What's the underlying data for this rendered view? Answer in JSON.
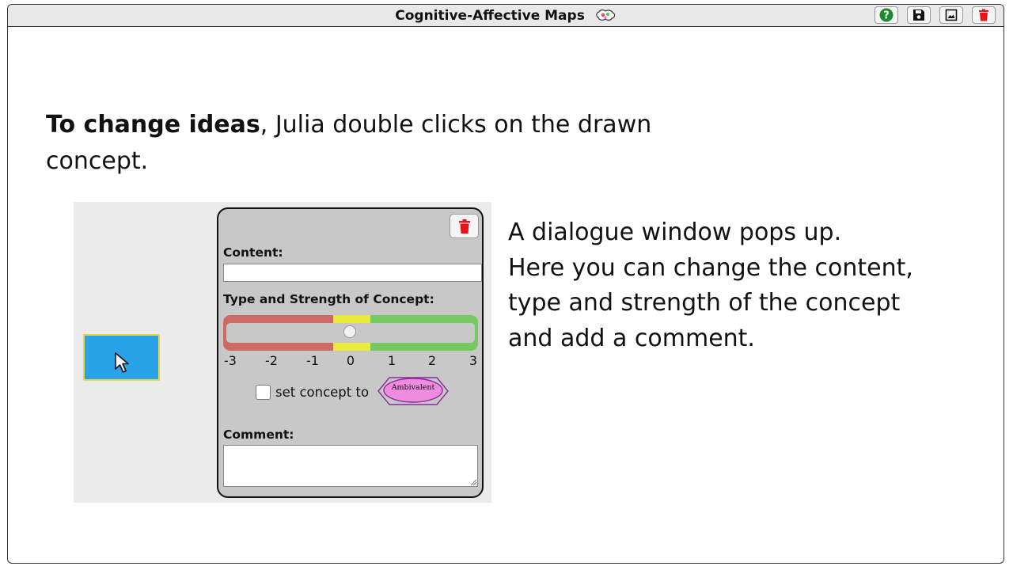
{
  "window": {
    "title": "Cognitive-Affective Maps",
    "buttons": [
      {
        "name": "help",
        "icon": "help-icon"
      },
      {
        "name": "save",
        "icon": "save-icon"
      },
      {
        "name": "image",
        "icon": "image-icon"
      },
      {
        "name": "delete",
        "icon": "trash-icon"
      }
    ]
  },
  "intro": {
    "bold": "To change ideas",
    "rest": ", Julia double clicks on the drawn",
    "line2": "concept."
  },
  "dialog": {
    "content_label": "Content:",
    "content_value": "",
    "type_label": "Type and Strength of Concept:",
    "slider_value": 0,
    "ticks": [
      "-3",
      "-2",
      "-1",
      "0",
      "1",
      "2",
      "3"
    ],
    "set_concept_label": "set concept to",
    "set_concept_checked": false,
    "ambivalent_label": "Ambivalent",
    "comment_label": "Comment:",
    "comment_value": ""
  },
  "explanation": {
    "lines": [
      "A dialogue window pops up.",
      "Here you can change the content,",
      "type and strength of the concept",
      "and add a comment."
    ]
  },
  "colors": {
    "negative": "#cd6a64",
    "neutral": "#eaea3a",
    "positive": "#76c860",
    "concept_fill": "#2aa2e8",
    "concept_border": "#e3d74a",
    "ambivalent_fill": "#f08ce0",
    "ambivalent_border": "#8b2a9a",
    "trash": "#e8141b",
    "help": "#1e8a2e"
  }
}
